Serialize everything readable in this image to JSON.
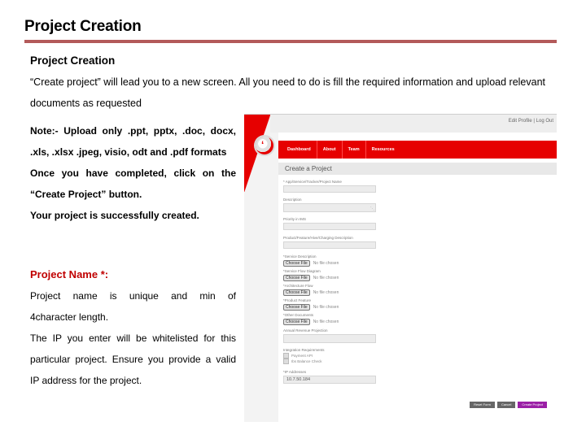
{
  "slide": {
    "title": "Project Creation",
    "rule_color": "#b35a5a"
  },
  "section": {
    "heading": "Project Creation",
    "intro": "“Create project”  will lead you to a new screen. All you need to do is fill the required information and upload relevant documents as requested"
  },
  "note": {
    "line1": "Note:- Upload only .ppt, pptx, .doc, docx,",
    "line2": ".xls, .xlsx .jpeg, visio, odt and .pdf formats",
    "line3": "Once you have completed, click on the",
    "line4": "“Create Project” button.",
    "line5": "Your project is successfully created."
  },
  "info": {
    "heading": "Project Name *:",
    "heading_color": "#c00000",
    "line1": "Project name is unique and min of",
    "line2": "4character length.",
    "line3": "The IP you enter will be whitelisted for this",
    "line4": "particular project. Ensure you provide a valid",
    "line5": "IP address for the project."
  },
  "screenshot": {
    "top_links": "Edit Profile | Log Out",
    "brand_color": "#e60000",
    "nav": [
      "Dashboard",
      "About",
      "Team",
      "Resources"
    ],
    "page_header": "Create a Project",
    "fields": [
      {
        "label": "* App/Service/Tracker/Project Name",
        "type": "text",
        "value": ""
      },
      {
        "label": "Description",
        "type": "textarea",
        "value": ""
      },
      {
        "label": "Priority in IMS",
        "type": "text",
        "value": ""
      },
      {
        "label": "Product/Feature/Hive/Charging Description",
        "type": "text",
        "value": ""
      }
    ],
    "file_fields": [
      {
        "label": "*Service Description",
        "button": "Choose File",
        "status": "No file chosen"
      },
      {
        "label": "*Service Flow Diagram",
        "button": "Choose File",
        "status": "No file chosen"
      },
      {
        "label": "*Architecture Flow",
        "button": "Choose File",
        "status": "No file chosen"
      },
      {
        "label": "*Product Feature",
        "button": "Choose File",
        "status": "No file chosen"
      },
      {
        "label": "*Other Documents",
        "button": "Choose File",
        "status": "No file chosen"
      }
    ],
    "revenue_field": {
      "label": "Annual Revenue Projection",
      "value": ""
    },
    "integration": {
      "label": "Integration Requirements",
      "options": [
        "Payment API",
        "Ibs Balance Check"
      ]
    },
    "ip_field": {
      "label": "*IP Addresses",
      "value": "10.7.50.184"
    },
    "buttons": [
      "Reset Form",
      "Cancel",
      "Create Project"
    ],
    "button_colors": {
      "secondary": "#666666",
      "primary": "#9b1fa6"
    }
  }
}
